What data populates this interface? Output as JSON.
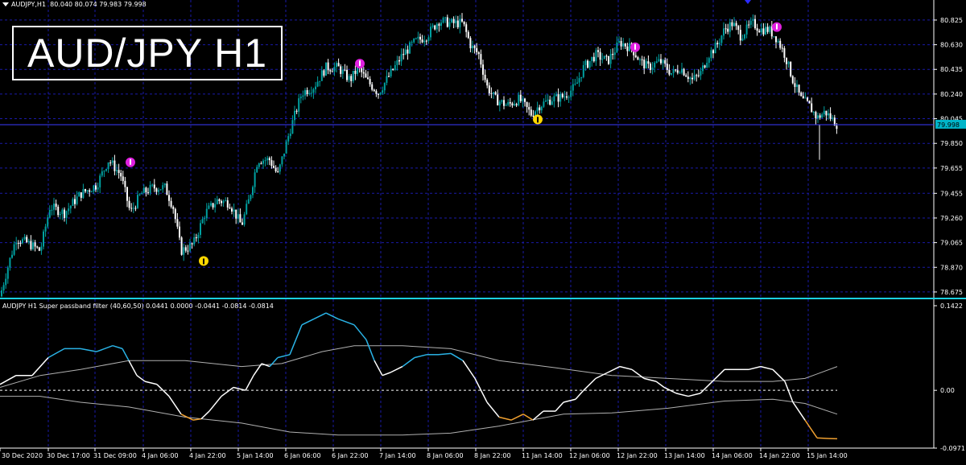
{
  "header": {
    "title": "AUDJPY,H1",
    "ohlc": "80.040 80.074 79.983 79.998",
    "big_label": "AUD/JPY H1"
  },
  "current_price": "79.998",
  "price_ticks": [
    "80.825",
    "80.630",
    "80.435",
    "80.240",
    "80.045",
    "79.850",
    "79.655",
    "79.455",
    "79.260",
    "79.065",
    "78.870",
    "78.675"
  ],
  "indicator": {
    "title": "AUDJPY H1 Super passband filter (40,60,50) 0.0441 0.0000 -0.0441 -0.0814 -0.0814",
    "ticks": [
      "0.1422",
      "0.00",
      "-0.0971"
    ]
  },
  "time_labels": [
    "30 Dec 2020",
    "30 Dec 17:00",
    "31 Dec 09:00",
    "4 Jan 06:00",
    "4 Jan 22:00",
    "5 Jan 14:00",
    "6 Jan 06:00",
    "6 Jan 22:00",
    "7 Jan 14:00",
    "8 Jan 06:00",
    "8 Jan 22:00",
    "11 Jan 14:00",
    "12 Jan 06:00",
    "12 Jan 22:00",
    "13 Jan 14:00",
    "14 Jan 06:00",
    "14 Jan 22:00",
    "15 Jan 14:00"
  ],
  "colors": {
    "background": "#000000",
    "grid": "#1a1aa8",
    "bull_candle": "#00a0a0",
    "bear_candle": "#ffffff",
    "osc_up": "#2ab3e6",
    "osc_mid": "#ffffff",
    "osc_down": "#f0a030",
    "bands": "#b0b0b0",
    "sell_arrow": "#e020e0",
    "buy_arrow": "#ffd700",
    "current_price_bg": "#00b4c8"
  },
  "chart_data": {
    "type": "line",
    "title": "AUD/JPY H1",
    "main_panel": {
      "kind": "candlestick",
      "ylim": [
        78.63,
        80.92
      ],
      "price_path": [
        [
          0,
          78.64
        ],
        [
          10,
          78.88
        ],
        [
          20,
          79.1
        ],
        [
          35,
          79.06
        ],
        [
          50,
          79.0
        ],
        [
          62,
          79.35
        ],
        [
          80,
          79.3
        ],
        [
          100,
          79.45
        ],
        [
          120,
          79.52
        ],
        [
          135,
          79.72
        ],
        [
          150,
          79.6
        ],
        [
          162,
          79.3
        ],
        [
          175,
          79.45
        ],
        [
          190,
          79.5
        ],
        [
          205,
          79.5
        ],
        [
          215,
          79.35
        ],
        [
          225,
          79.0
        ],
        [
          240,
          79.05
        ],
        [
          255,
          79.3
        ],
        [
          270,
          79.4
        ],
        [
          285,
          79.38
        ],
        [
          300,
          79.2
        ],
        [
          310,
          79.42
        ],
        [
          320,
          79.72
        ],
        [
          335,
          79.72
        ],
        [
          345,
          79.6
        ],
        [
          360,
          79.95
        ],
        [
          375,
          80.25
        ],
        [
          390,
          80.3
        ],
        [
          405,
          80.45
        ],
        [
          420,
          80.45
        ],
        [
          435,
          80.35
        ],
        [
          445,
          80.45
        ],
        [
          455,
          80.35
        ],
        [
          470,
          80.25
        ],
        [
          485,
          80.4
        ],
        [
          500,
          80.55
        ],
        [
          515,
          80.65
        ],
        [
          530,
          80.7
        ],
        [
          545,
          80.82
        ],
        [
          560,
          80.8
        ],
        [
          575,
          80.8
        ],
        [
          585,
          80.62
        ],
        [
          595,
          80.55
        ],
        [
          605,
          80.3
        ],
        [
          615,
          80.2
        ],
        [
          630,
          80.15
        ],
        [
          645,
          80.2
        ],
        [
          660,
          80.08
        ],
        [
          670,
          80.15
        ],
        [
          685,
          80.2
        ],
        [
          700,
          80.22
        ],
        [
          715,
          80.3
        ],
        [
          725,
          80.45
        ],
        [
          740,
          80.55
        ],
        [
          755,
          80.5
        ],
        [
          770,
          80.65
        ],
        [
          785,
          80.6
        ],
        [
          795,
          80.5
        ],
        [
          805,
          80.45
        ],
        [
          820,
          80.5
        ],
        [
          835,
          80.4
        ],
        [
          845,
          80.45
        ],
        [
          860,
          80.35
        ],
        [
          870,
          80.4
        ],
        [
          880,
          80.55
        ],
        [
          890,
          80.62
        ],
        [
          900,
          80.75
        ],
        [
          910,
          80.8
        ],
        [
          920,
          80.7
        ],
        [
          935,
          80.8
        ],
        [
          945,
          80.75
        ],
        [
          955,
          80.75
        ],
        [
          965,
          80.68
        ],
        [
          975,
          80.55
        ],
        [
          985,
          80.35
        ],
        [
          995,
          80.2
        ],
        [
          1005,
          80.15
        ],
        [
          1015,
          80.05
        ],
        [
          1025,
          80.1
        ],
        [
          1040,
          79.998
        ]
      ],
      "sell_arrows": [
        [
          162,
          79.7
        ],
        [
          447,
          80.48
        ],
        [
          789,
          80.61
        ],
        [
          965,
          80.77
        ]
      ],
      "buy_arrows": [
        [
          253,
          78.92
        ],
        [
          668,
          80.04
        ]
      ],
      "current_price": 79.998
    },
    "indicator_panel": {
      "name": "Super passband filter (40,60,50)",
      "ylim": [
        -0.0971,
        0.1422
      ],
      "oscillator": [
        [
          0,
          0.01
        ],
        [
          20,
          0.025
        ],
        [
          40,
          0.025
        ],
        [
          60,
          0.055
        ],
        [
          80,
          0.07
        ],
        [
          100,
          0.07
        ],
        [
          120,
          0.065
        ],
        [
          140,
          0.075
        ],
        [
          152,
          0.07
        ],
        [
          160,
          0.05
        ],
        [
          170,
          0.025
        ],
        [
          180,
          0.015
        ],
        [
          195,
          0.01
        ],
        [
          210,
          -0.01
        ],
        [
          225,
          -0.04
        ],
        [
          240,
          -0.05
        ],
        [
          250,
          -0.048
        ],
        [
          260,
          -0.035
        ],
        [
          275,
          -0.01
        ],
        [
          290,
          0.005
        ],
        [
          305,
          0.0
        ],
        [
          315,
          0.025
        ],
        [
          325,
          0.045
        ],
        [
          335,
          0.04
        ],
        [
          345,
          0.055
        ],
        [
          360,
          0.06
        ],
        [
          375,
          0.11
        ],
        [
          390,
          0.12
        ],
        [
          405,
          0.13
        ],
        [
          420,
          0.12
        ],
        [
          440,
          0.11
        ],
        [
          455,
          0.085
        ],
        [
          465,
          0.05
        ],
        [
          475,
          0.025
        ],
        [
          485,
          0.03
        ],
        [
          500,
          0.04
        ],
        [
          515,
          0.055
        ],
        [
          530,
          0.06
        ],
        [
          545,
          0.06
        ],
        [
          560,
          0.062
        ],
        [
          575,
          0.05
        ],
        [
          590,
          0.02
        ],
        [
          605,
          -0.02
        ],
        [
          620,
          -0.045
        ],
        [
          635,
          -0.05
        ],
        [
          650,
          -0.04
        ],
        [
          662,
          -0.05
        ],
        [
          675,
          -0.035
        ],
        [
          690,
          -0.035
        ],
        [
          700,
          -0.02
        ],
        [
          715,
          -0.015
        ],
        [
          725,
          0.0
        ],
        [
          740,
          0.02
        ],
        [
          755,
          0.03
        ],
        [
          770,
          0.04
        ],
        [
          785,
          0.035
        ],
        [
          800,
          0.02
        ],
        [
          815,
          0.015
        ],
        [
          825,
          0.005
        ],
        [
          840,
          -0.005
        ],
        [
          855,
          -0.01
        ],
        [
          870,
          -0.005
        ],
        [
          885,
          0.015
        ],
        [
          900,
          0.035
        ],
        [
          915,
          0.035
        ],
        [
          930,
          0.035
        ],
        [
          945,
          0.04
        ],
        [
          960,
          0.035
        ],
        [
          975,
          0.015
        ],
        [
          985,
          -0.02
        ],
        [
          1000,
          -0.05
        ],
        [
          1015,
          -0.08
        ],
        [
          1030,
          -0.081
        ],
        [
          1040,
          -0.0814
        ]
      ],
      "upper_band": [
        [
          0,
          0.005
        ],
        [
          50,
          0.025
        ],
        [
          100,
          0.035
        ],
        [
          160,
          0.05
        ],
        [
          230,
          0.05
        ],
        [
          300,
          0.04
        ],
        [
          350,
          0.045
        ],
        [
          400,
          0.065
        ],
        [
          440,
          0.075
        ],
        [
          500,
          0.075
        ],
        [
          560,
          0.07
        ],
        [
          620,
          0.05
        ],
        [
          690,
          0.038
        ],
        [
          760,
          0.025
        ],
        [
          830,
          0.02
        ],
        [
          900,
          0.015
        ],
        [
          960,
          0.015
        ],
        [
          1000,
          0.02
        ],
        [
          1040,
          0.04
        ]
      ],
      "lower_band": [
        [
          0,
          -0.01
        ],
        [
          50,
          -0.01
        ],
        [
          100,
          -0.02
        ],
        [
          160,
          -0.028
        ],
        [
          230,
          -0.045
        ],
        [
          300,
          -0.055
        ],
        [
          360,
          -0.07
        ],
        [
          420,
          -0.075
        ],
        [
          500,
          -0.075
        ],
        [
          560,
          -0.072
        ],
        [
          620,
          -0.06
        ],
        [
          700,
          -0.04
        ],
        [
          760,
          -0.038
        ],
        [
          830,
          -0.03
        ],
        [
          900,
          -0.018
        ],
        [
          960,
          -0.015
        ],
        [
          1000,
          -0.022
        ],
        [
          1040,
          -0.04
        ]
      ],
      "up_threshold": 0.0441,
      "down_threshold": -0.0441
    }
  }
}
